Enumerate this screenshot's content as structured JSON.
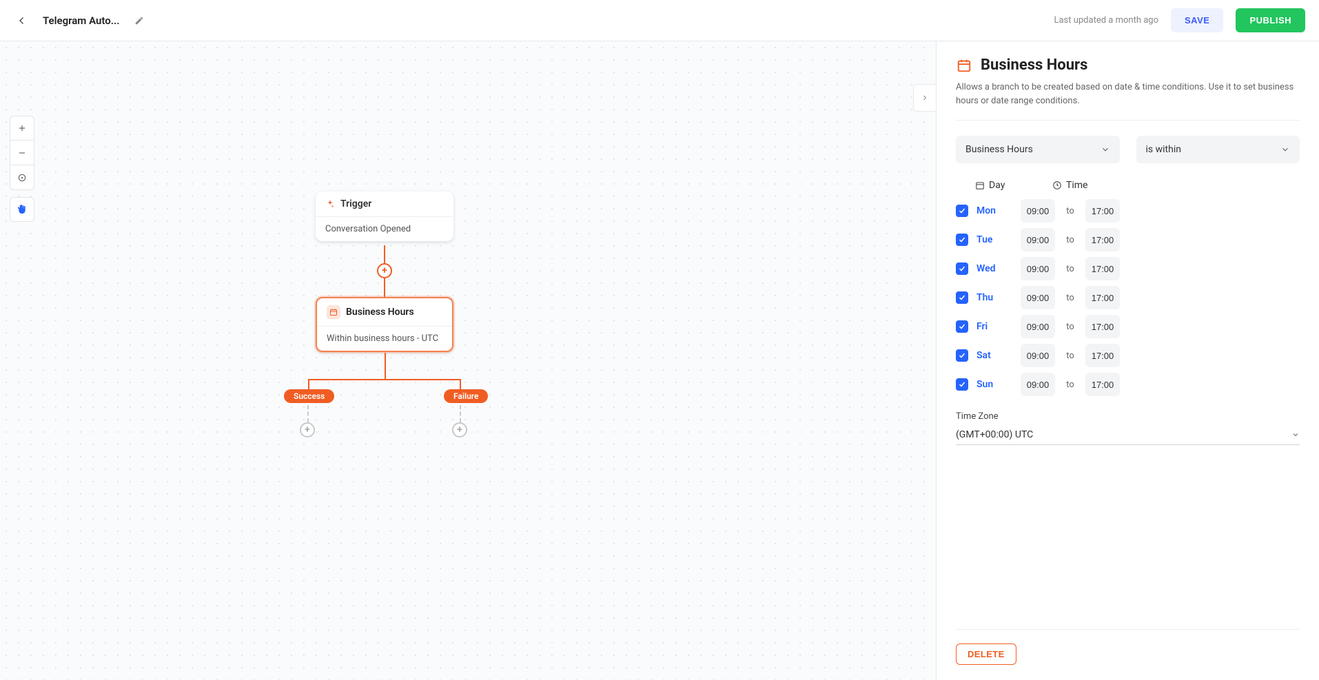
{
  "topbar": {
    "title": "Telegram Auto...",
    "last_updated": "Last updated a month ago",
    "save_label": "SAVE",
    "publish_label": "PUBLISH"
  },
  "canvas": {
    "trigger": {
      "title": "Trigger",
      "body": "Conversation Opened"
    },
    "business_hours": {
      "title": "Business Hours",
      "body": "Within business hours - UTC"
    },
    "success_label": "Success",
    "failure_label": "Failure"
  },
  "panel": {
    "title": "Business Hours",
    "desc": "Allows a branch to be created based on date & time conditions. Use it to set business hours or date range conditions.",
    "type_select": "Business Hours",
    "condition_select": "is within",
    "day_header": "Day",
    "time_header": "Time",
    "to_label": "to",
    "timezone_label": "Time Zone",
    "timezone_value": "(GMT+00:00) UTC",
    "delete_label": "DELETE",
    "days": [
      {
        "name": "Mon",
        "start": "09:00",
        "end": "17:00"
      },
      {
        "name": "Tue",
        "start": "09:00",
        "end": "17:00"
      },
      {
        "name": "Wed",
        "start": "09:00",
        "end": "17:00"
      },
      {
        "name": "Thu",
        "start": "09:00",
        "end": "17:00"
      },
      {
        "name": "Fri",
        "start": "09:00",
        "end": "17:00"
      },
      {
        "name": "Sat",
        "start": "09:00",
        "end": "17:00"
      },
      {
        "name": "Sun",
        "start": "09:00",
        "end": "17:00"
      }
    ]
  },
  "colors": {
    "accent": "#f05d23",
    "primary": "#2563ff",
    "publish": "#22c55e"
  }
}
